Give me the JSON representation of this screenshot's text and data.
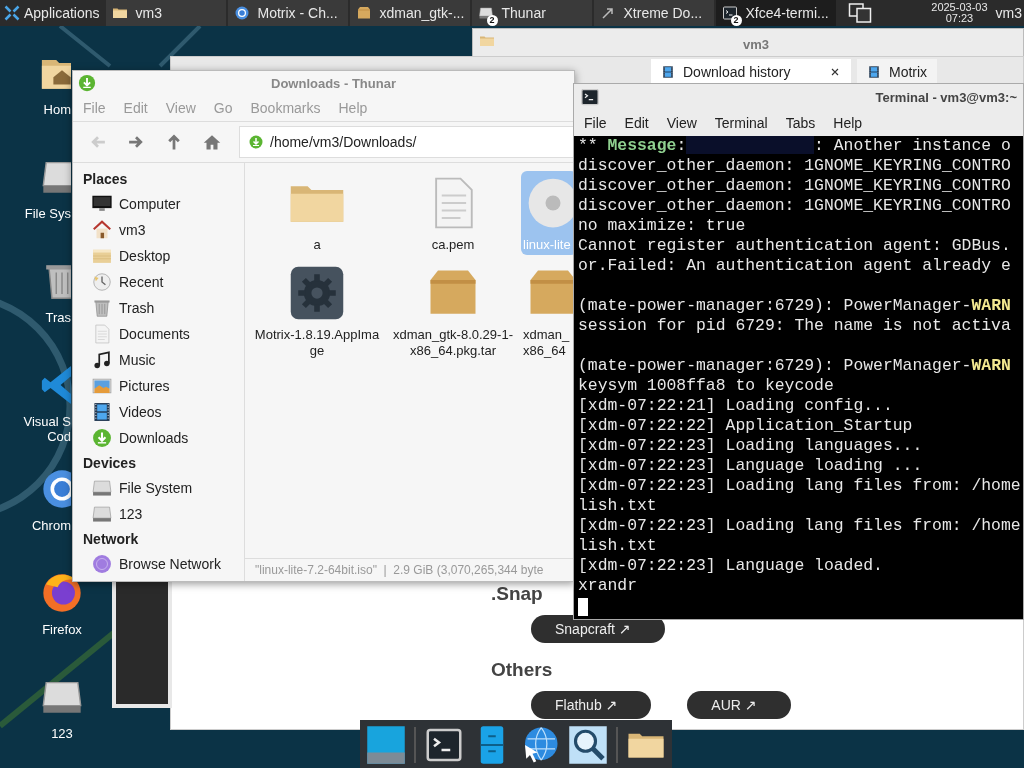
{
  "top_panel": {
    "menu": {
      "label": "Applications"
    },
    "tasks": [
      {
        "label": "vm3",
        "kind": "folder",
        "selected": false
      },
      {
        "label": "Motrix - Ch...",
        "kind": "chrome",
        "selected": false
      },
      {
        "label": "xdman_gtk-...",
        "kind": "package",
        "selected": false
      },
      {
        "label": "Thunar",
        "kind": "drive",
        "count": "2",
        "selected": false
      },
      {
        "label": "Xtreme Do...",
        "kind": "arrow",
        "selected": false
      },
      {
        "label": "Xfce4-termi...",
        "kind": "terminal",
        "count": "2",
        "selected": true
      }
    ],
    "clock": {
      "date": "2025-03-03",
      "time": "07:23"
    },
    "user": "vm3"
  },
  "desktop_icons": [
    {
      "label": "Hom",
      "kind": "home",
      "clipped": true
    },
    {
      "label": "File Sys",
      "kind": "drive",
      "clipped": true
    },
    {
      "label": "Tras",
      "kind": "trash",
      "clipped": true
    },
    {
      "label": "Visual S\nCod",
      "kind": "vscode",
      "clipped": true
    },
    {
      "label": "Chrom",
      "kind": "chrome",
      "clipped": true
    },
    {
      "label": "Firefox",
      "kind": "firefox",
      "clipped": false
    },
    {
      "label": "123",
      "kind": "drive",
      "clipped": false
    }
  ],
  "folder_window": {
    "title": "vm3"
  },
  "browser": {
    "tabs": [
      {
        "label": "Download history",
        "selected": true,
        "closable": true
      },
      {
        "label": "Motrix",
        "selected": false,
        "closable": false
      }
    ],
    "sections": [
      {
        "heading": ".Snap",
        "links": [
          "Snapcraft ↗"
        ]
      },
      {
        "heading": "Others",
        "links": [
          "Flathub ↗",
          "AUR ↗"
        ]
      }
    ]
  },
  "thunar": {
    "title": "Downloads - Thunar",
    "menu": [
      "File",
      "Edit",
      "View",
      "Go",
      "Bookmarks",
      "Help"
    ],
    "toolbar": [
      {
        "kind": "back",
        "disabled": true
      },
      {
        "kind": "forward",
        "disabled": false
      },
      {
        "kind": "up",
        "disabled": false
      },
      {
        "kind": "home",
        "disabled": false
      }
    ],
    "location": "/home/vm3/Downloads/",
    "sidebar": [
      {
        "heading": "Places",
        "items": [
          {
            "label": "Computer",
            "kind": "computer"
          },
          {
            "label": "vm3",
            "kind": "house"
          },
          {
            "label": "Desktop",
            "kind": "desktopfolder"
          },
          {
            "label": "Recent",
            "kind": "recent"
          },
          {
            "label": "Trash",
            "kind": "trash"
          },
          {
            "label": "Documents",
            "kind": "document"
          },
          {
            "label": "Music",
            "kind": "music"
          },
          {
            "label": "Pictures",
            "kind": "pictures"
          },
          {
            "label": "Videos",
            "kind": "videos"
          },
          {
            "label": "Downloads",
            "kind": "download"
          }
        ]
      },
      {
        "heading": "Devices",
        "items": [
          {
            "label": "File System",
            "kind": "drive"
          },
          {
            "label": "123",
            "kind": "drive"
          }
        ]
      },
      {
        "heading": "Network",
        "items": [
          {
            "label": "Browse Network",
            "kind": "network"
          }
        ]
      }
    ],
    "files": [
      {
        "name": "a",
        "kind": "folder",
        "selected": false,
        "clipped": false
      },
      {
        "name": "ca.pem",
        "kind": "document",
        "selected": false,
        "clipped": false
      },
      {
        "name": "linux-lite",
        "kind": "disc",
        "selected": true,
        "clipped": true
      },
      {
        "name": "Motrix-1.8.19.AppIma\nge",
        "kind": "app",
        "selected": false,
        "clipped": false
      },
      {
        "name": "xdman_gtk-8.0.29-1-\nx86_64.pkg.tar",
        "kind": "package",
        "selected": false,
        "clipped": false
      },
      {
        "name": "xdman_\nx86_64",
        "kind": "package",
        "selected": false,
        "clipped": true
      }
    ],
    "status": "\"linux-lite-7.2-64bit.iso\"  |  2.9 GiB (3,070,265,344 byte"
  },
  "terminal": {
    "title": "Terminal - vm3@vm3:~",
    "menu": [
      "File",
      "Edit",
      "View",
      "Terminal",
      "Tabs",
      "Help"
    ],
    "lines": [
      {
        "segments": [
          {
            "text": "** ",
            "kind": "plain"
          },
          {
            "text": "Message",
            "kind": "green"
          },
          {
            "text": ":",
            "kind": "plain"
          },
          {
            "kind": "redacted"
          },
          {
            "text": ": Another instance o",
            "kind": "plain"
          }
        ],
        "space_before": false
      },
      {
        "segments": [
          {
            "text": "discover_other_daemon: 1GNOME_KEYRING_CONTRO",
            "kind": "plain"
          }
        ],
        "space_before": false
      },
      {
        "segments": [
          {
            "text": "discover_other_daemon: 1GNOME_KEYRING_CONTRO",
            "kind": "plain"
          }
        ],
        "space_before": false
      },
      {
        "segments": [
          {
            "text": "discover_other_daemon: 1GNOME_KEYRING_CONTRO",
            "kind": "plain"
          }
        ],
        "space_before": false
      },
      {
        "segments": [
          {
            "text": "no maximize: true",
            "kind": "plain"
          }
        ],
        "space_before": false
      },
      {
        "segments": [
          {
            "text": "Cannot register authentication agent: GDBus.",
            "kind": "plain"
          }
        ],
        "space_before": false
      },
      {
        "segments": [
          {
            "text": "or.Failed: An authentication agent already e",
            "kind": "plain"
          }
        ],
        "space_before": false
      },
      {
        "segments": [
          {
            "text": "(mate-power-manager:6729): PowerManager-",
            "kind": "plain"
          },
          {
            "text": "WARN",
            "kind": "yellow"
          }
        ],
        "space_before": true
      },
      {
        "segments": [
          {
            "text": "session for pid 6729: The name is not activa",
            "kind": "plain"
          }
        ],
        "space_before": false
      },
      {
        "segments": [
          {
            "text": "(mate-power-manager:6729): PowerManager-",
            "kind": "plain"
          },
          {
            "text": "WARN",
            "kind": "yellow"
          }
        ],
        "space_before": true
      },
      {
        "segments": [
          {
            "text": "keysym 1008ffa8 to keycode",
            "kind": "plain"
          }
        ],
        "space_before": false
      },
      {
        "segments": [
          {
            "text": "[xdm-07:22:21] Loading config...",
            "kind": "plain"
          }
        ],
        "space_before": false
      },
      {
        "segments": [
          {
            "text": "[xdm-07:22:22] Application_Startup",
            "kind": "plain"
          }
        ],
        "space_before": false
      },
      {
        "segments": [
          {
            "text": "[xdm-07:22:23] Loading languages...",
            "kind": "plain"
          }
        ],
        "space_before": false
      },
      {
        "segments": [
          {
            "text": "[xdm-07:22:23] Language loading ...",
            "kind": "plain"
          }
        ],
        "space_before": false
      },
      {
        "segments": [
          {
            "text": "[xdm-07:22:23] Loading lang files from: /home",
            "kind": "plain"
          }
        ],
        "space_before": false
      },
      {
        "segments": [
          {
            "text": "lish.txt",
            "kind": "plain"
          }
        ],
        "space_before": false
      },
      {
        "segments": [
          {
            "text": "[xdm-07:22:23] Loading lang files from: /home",
            "kind": "plain"
          }
        ],
        "space_before": false
      },
      {
        "segments": [
          {
            "text": "lish.txt",
            "kind": "plain"
          }
        ],
        "space_before": false
      },
      {
        "segments": [
          {
            "text": "[xdm-07:22:23] Language loaded.",
            "kind": "plain"
          }
        ],
        "space_before": false
      },
      {
        "segments": [
          {
            "text": "xrandr",
            "kind": "plain"
          }
        ],
        "space_before": false
      }
    ],
    "cursor": true
  },
  "dock": {
    "items": [
      {
        "kind": "desktop",
        "separator_after": true
      },
      {
        "kind": "terminal",
        "separator_after": false
      },
      {
        "kind": "cabinet",
        "separator_after": false
      },
      {
        "kind": "globe",
        "separator_after": false
      },
      {
        "kind": "magnifier",
        "separator_after": true
      },
      {
        "kind": "folder",
        "separator_after": false
      }
    ]
  }
}
